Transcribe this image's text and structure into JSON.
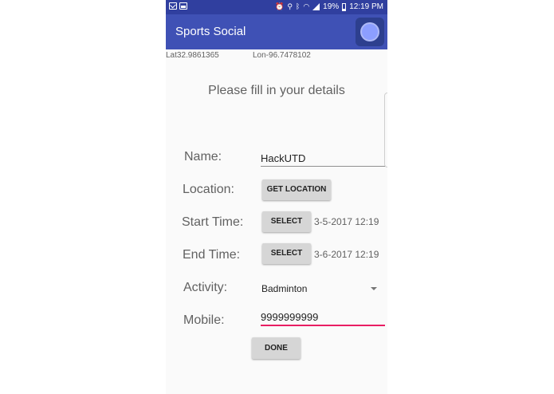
{
  "status_bar": {
    "battery": "19%",
    "time": "12:19 PM"
  },
  "toolbar": {
    "title": "Sports Social"
  },
  "coords": {
    "lat": "Lat32.9861365",
    "lon": "Lon-96.7478102"
  },
  "form": {
    "prompt": "Please fill in your details",
    "name_label": "Name:",
    "name_value": "HackUTD",
    "location_label": "Location:",
    "get_location_button": "GET LOCATION",
    "start_label": "Start Time:",
    "start_select_button": "SELECT",
    "start_value": "3-5-2017 12:19",
    "end_label": "End Time:",
    "end_select_button": "SELECT",
    "end_value": "3-6-2017 12:19",
    "activity_label": "Activity:",
    "activity_value": "Badminton",
    "mobile_label": "Mobile:",
    "mobile_value": "9999999999",
    "done_button": "DONE"
  },
  "colors": {
    "status_bar": "#303f9f",
    "toolbar": "#3f51b5",
    "accent": "#e91e63"
  },
  "icons": [
    "mail-icon",
    "image-icon",
    "alarm-icon",
    "location-icon",
    "bluetooth-icon",
    "wifi-icon",
    "signal-icon",
    "battery-icon",
    "overflow-icon",
    "dropdown-caret-icon"
  ]
}
